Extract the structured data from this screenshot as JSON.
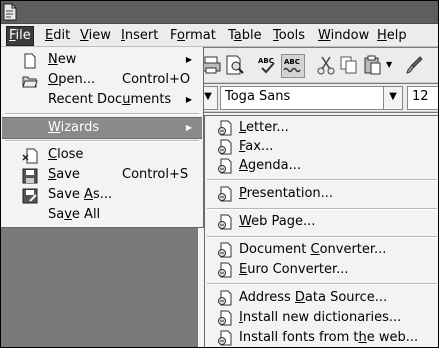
{
  "menubar": {
    "items": [
      {
        "label": "File",
        "ul": "F",
        "rest": "ile"
      },
      {
        "label": "Edit",
        "ul": "E",
        "rest": "dit"
      },
      {
        "label": "View",
        "ul": "V",
        "rest": "iew"
      },
      {
        "label": "Insert",
        "ul": "I",
        "rest": "nsert"
      },
      {
        "label": "Format",
        "pre": "F",
        "ul": "o",
        "rest": "rmat"
      },
      {
        "label": "Table",
        "pre": "T",
        "ul": "a",
        "rest": "ble"
      },
      {
        "label": "Tools",
        "ul": "T",
        "rest": "ools"
      },
      {
        "label": "Window",
        "ul": "W",
        "rest": "indow"
      },
      {
        "label": "Help",
        "ul": "H",
        "rest": "elp"
      }
    ]
  },
  "toolbar": {
    "icons": [
      "print-icon",
      "page-preview-icon",
      "spellcheck-icon",
      "autospellcheck-icon",
      "cut-icon",
      "copy-icon",
      "paste-icon",
      "format-paintbrush-icon"
    ],
    "font_name": "Toga Sans",
    "font_size": "12"
  },
  "file_menu": {
    "new": {
      "ul": "N",
      "rest": "ew"
    },
    "open": {
      "ul": "O",
      "rest": "pen...",
      "shortcut": "Control+O"
    },
    "recent": {
      "pre": "Recent Doc",
      "ul": "u",
      "rest": "ments"
    },
    "wizards": {
      "ul": "W",
      "rest": "izards"
    },
    "close": {
      "ul": "C",
      "rest": "lose"
    },
    "save": {
      "ul": "S",
      "rest": "ave",
      "shortcut": "Control+S"
    },
    "save_as": {
      "pre": "Save ",
      "ul": "A",
      "rest": "s..."
    },
    "save_all": {
      "pre": "Sa",
      "ul": "v",
      "rest": "e All"
    }
  },
  "wizards_menu": {
    "letter": {
      "ul": "L",
      "rest": "etter..."
    },
    "fax": {
      "ul": "F",
      "rest": "ax..."
    },
    "agenda": {
      "ul": "A",
      "rest": "genda..."
    },
    "presentation": {
      "ul": "P",
      "rest": "resentation..."
    },
    "web_page": {
      "ul": "W",
      "rest": "eb Page..."
    },
    "document_converter": {
      "pre": "Document ",
      "ul": "C",
      "rest": "onverter..."
    },
    "euro_converter": {
      "ul": "E",
      "rest": "uro Converter..."
    },
    "address_data_source": {
      "pre": "Address ",
      "ul": "D",
      "rest": "ata Source..."
    },
    "install_dictionaries": {
      "ul": "I",
      "rest": "nstall new dictionaries..."
    },
    "install_fonts": {
      "pre": "Install fonts from t",
      "ul": "h",
      "rest": "e web..."
    }
  },
  "colors": {
    "highlight": "#8a8a8a",
    "menu_bg": "#f3f3f3",
    "menubar_bg": "#ececec"
  }
}
